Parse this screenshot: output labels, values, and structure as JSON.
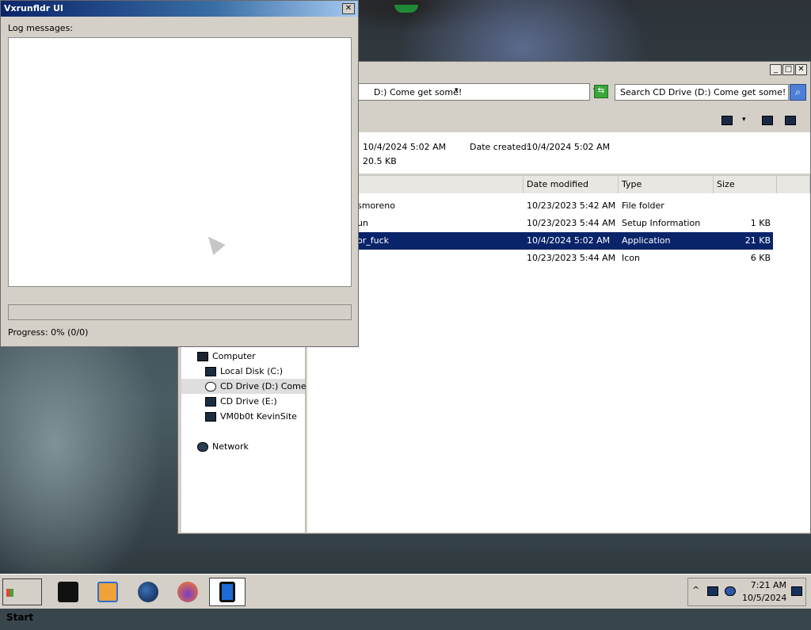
{
  "desktop": {},
  "vx": {
    "title": "Vxrunfldr UI",
    "close_label": "✕",
    "log_label": "Log messages:",
    "progress_text": "Progress: 0% (0/0)",
    "progress_fraction": 0
  },
  "explorer": {
    "window_buttons": [
      "_",
      "□",
      "✕"
    ],
    "address": "D:) Come get some!",
    "address_arrow": "▸",
    "address_dropdown": "▾",
    "search_placeholder": "Search CD Drive (D:) Come get some!",
    "search_icon": "magnifier-icon",
    "details": {
      "date_modified_value": "10/4/2024 5:02 AM",
      "size_value": "20.5 KB",
      "date_created_label": "Date created:",
      "date_created_value": "10/4/2024 5:02 AM"
    },
    "columns": [
      "Date modified",
      "Type",
      "Size"
    ],
    "files": [
      {
        "name": "smoreno",
        "date": "10/23/2023 5:42 AM",
        "type": "File folder",
        "size": ""
      },
      {
        "name": "un",
        "date": "10/23/2023 5:44 AM",
        "type": "Setup Information",
        "size": "1 KB"
      },
      {
        "name": "or_fuck",
        "date": "10/4/2024 5:02 AM",
        "type": "Application",
        "size": "21 KB",
        "selected": true
      },
      {
        "name": "",
        "date": "10/23/2023 5:44 AM",
        "type": "Icon",
        "size": "6 KB"
      }
    ],
    "nav": [
      {
        "label": "Computer",
        "icon": "computer-icon"
      },
      {
        "label": "Local Disk (C:)",
        "icon": "disk-icon"
      },
      {
        "label": "CD Drive (D:) Come ge",
        "icon": "cd-icon",
        "selected": true
      },
      {
        "label": "CD Drive (E:)",
        "icon": "disk-icon"
      },
      {
        "label": "VM0b0t KevinSite",
        "icon": "network-drive-icon"
      },
      {
        "label": "Network",
        "icon": "network-icon"
      }
    ]
  },
  "taskbar": {
    "start_label": "Start",
    "apps": [
      "command-prompt-icon",
      "media-player-icon",
      "globe-icon",
      "firefox-icon",
      "tablet-icon"
    ],
    "tray_chevron": "^",
    "time": "7:21 AM",
    "date": "10/5/2024"
  }
}
